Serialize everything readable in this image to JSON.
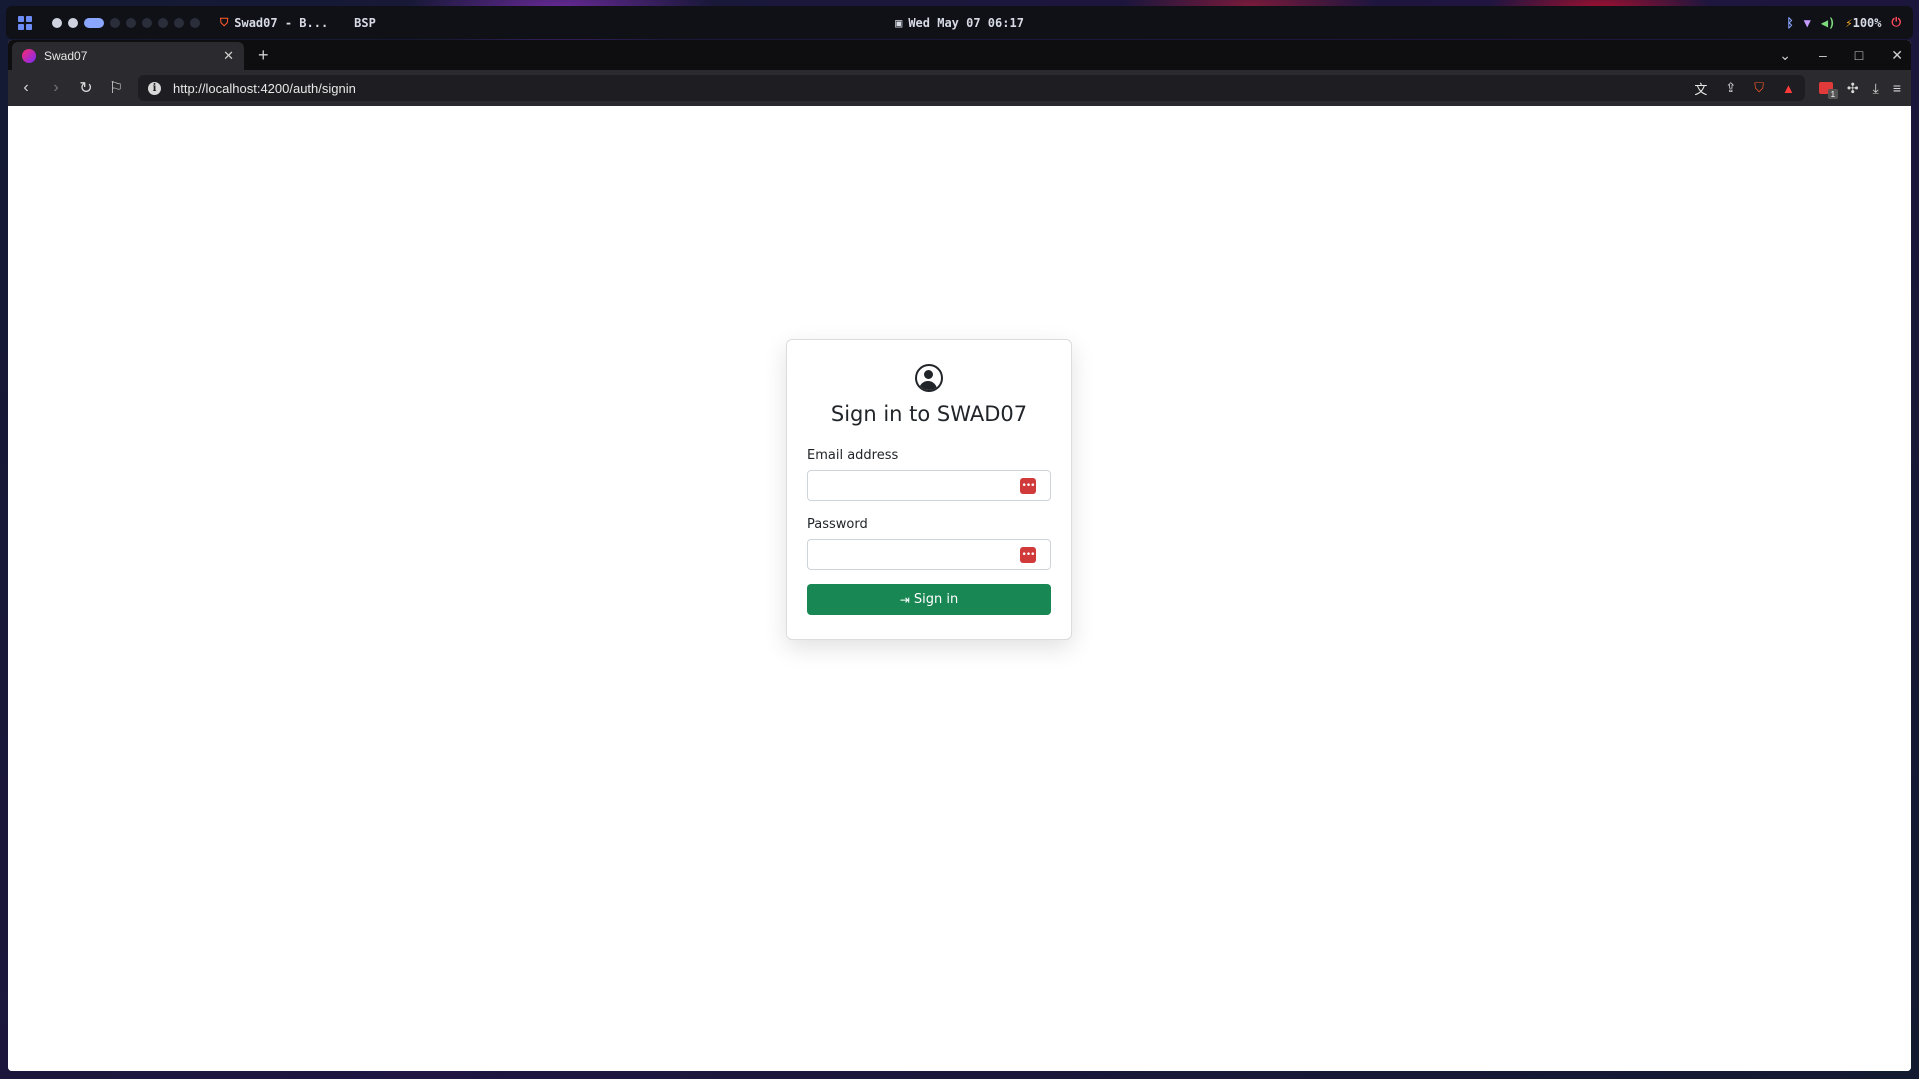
{
  "system_bar": {
    "window_title": "Swad07 - B...",
    "layout_mode": "BSP",
    "datetime": "Wed May 07 06:17",
    "battery": "100%"
  },
  "browser": {
    "tab": {
      "title": "Swad07",
      "close_label": "✕"
    },
    "new_tab_label": "+",
    "url": "http://localhost:4200/auth/signin"
  },
  "signin": {
    "title": "Sign in to SWAD07",
    "email_label": "Email address",
    "email_value": "",
    "password_label": "Password",
    "password_value": "",
    "submit_label": "Sign in"
  },
  "colors": {
    "primary_button": "#198754",
    "password_manager_icon": "#d03a3a"
  }
}
